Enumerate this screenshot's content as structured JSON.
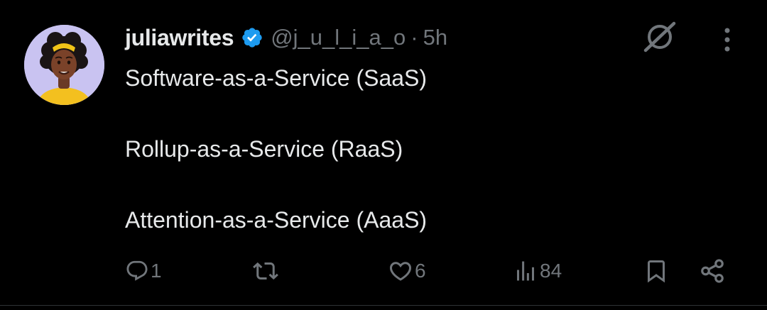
{
  "tweet": {
    "author": {
      "display_name": "juliawrites",
      "verified": true,
      "handle": "@j_u_l_i_a_o",
      "separator": "·",
      "time": "5h"
    },
    "lines": [
      "Software-as-a-Service (SaaS)",
      "Rollup-as-a-Service (RaaS)",
      "Attention-as-a-Service (AaaS)"
    ],
    "actions": {
      "replies": "1",
      "reposts": "",
      "likes": "6",
      "views": "84"
    }
  },
  "icons": {
    "verified": "verified-badge-icon",
    "grok": "grok-icon",
    "more": "more-vertical-icon",
    "reply": "reply-icon",
    "repost": "repost-icon",
    "like": "heart-icon",
    "views": "views-icon",
    "bookmark": "bookmark-icon",
    "share": "share-icon"
  },
  "colors": {
    "background": "#000000",
    "text_primary": "#e7e9ea",
    "text_secondary": "#71767b",
    "verified_blue": "#1d9bf0",
    "avatar_bg": "#c9c3f1"
  }
}
